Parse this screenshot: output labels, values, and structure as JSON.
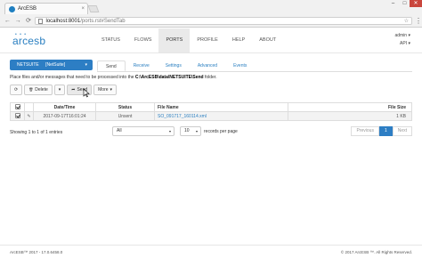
{
  "browser": {
    "tab_title": "ArcESB",
    "tab_close": "×",
    "url_host": "localhost:8001",
    "url_path": "/ports.rst#SendTab",
    "win_min": "–",
    "win_max": "□",
    "win_close": "✕",
    "back": "←",
    "forward": "→",
    "reload": "⟳",
    "star": "☆",
    "menu": "⋮"
  },
  "app": {
    "logo": "arcesb",
    "nav": [
      "STATUS",
      "FLOWS",
      "PORTS",
      "PROFILE",
      "HELP",
      "ABOUT"
    ],
    "active_nav": "PORTS",
    "user": "admin ▾",
    "api": "API ▾"
  },
  "connector": {
    "name": "NETSUITE",
    "type": "[NetSuite]",
    "caret": "▾",
    "tabs": [
      "Send",
      "Receive",
      "Settings",
      "Advanced",
      "Events"
    ],
    "active_tab": "Send",
    "info_prefix": "Place files and/or messages that need to be processed into the ",
    "info_path": "C:\\ArcESB\\data\\NETSUITE\\Send",
    "info_suffix": " folder."
  },
  "toolbar": {
    "refresh": "⟳",
    "delete": "Delete",
    "delete_icon": "🗑",
    "caret": "▾",
    "send": "Send",
    "send_icon": "➦",
    "more": "More"
  },
  "table": {
    "headers": [
      "Date/Time",
      "Status",
      "File Name",
      "File Size"
    ],
    "rows": [
      {
        "checked": true,
        "icon": "✎",
        "datetime": "2017-09-17T16:01:24",
        "status": "Unsent",
        "filename": "SO_091717_160114.xml",
        "size": "1 KB"
      }
    ]
  },
  "footer": {
    "showing": "Showing 1 to 1 of 1 entries",
    "status_filter": "All",
    "records": "10",
    "records_label": "records per page",
    "prev": "Previous",
    "page": "1",
    "next": "Next",
    "version": "ArcESB™ 2017 - 17.0.6458.0",
    "copyright": "© 2017 ArcESB ™. All Rights Reserved."
  }
}
